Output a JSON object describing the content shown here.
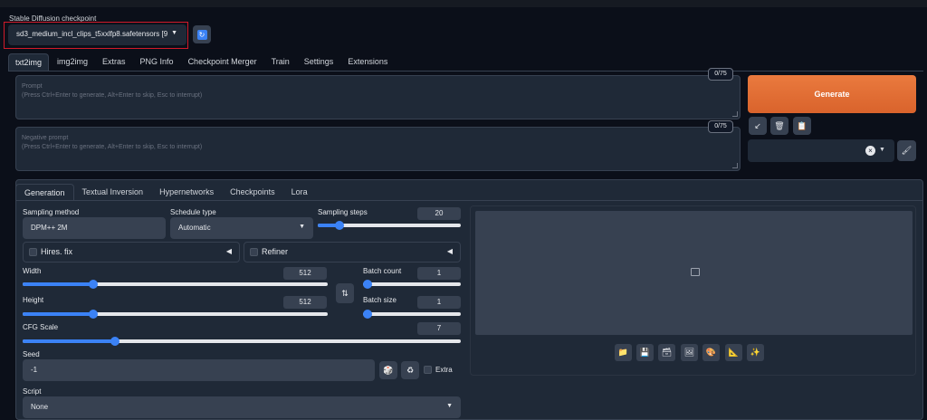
{
  "checkpoint": {
    "label": "Stable Diffusion checkpoint",
    "value": "sd3_medium_incl_clips_t5xxlfp8.safetensors [9"
  },
  "main_tabs": [
    {
      "label": "txt2img",
      "active": true
    },
    {
      "label": "img2img"
    },
    {
      "label": "Extras"
    },
    {
      "label": "PNG Info"
    },
    {
      "label": "Checkpoint Merger"
    },
    {
      "label": "Train"
    },
    {
      "label": "Settings"
    },
    {
      "label": "Extensions"
    }
  ],
  "prompt": {
    "placeholder_title": "Prompt",
    "placeholder_hint": "(Press Ctrl+Enter to generate, Alt+Enter to skip, Esc to interrupt)",
    "counter": "0/75"
  },
  "negative_prompt": {
    "placeholder_title": "Negative prompt",
    "placeholder_hint": "(Press Ctrl+Enter to generate, Alt+Enter to skip, Esc to interrupt)",
    "counter": "0/75"
  },
  "generate_label": "Generate",
  "sub_tabs": [
    {
      "label": "Generation",
      "active": true
    },
    {
      "label": "Textual Inversion"
    },
    {
      "label": "Hypernetworks"
    },
    {
      "label": "Checkpoints"
    },
    {
      "label": "Lora"
    }
  ],
  "sampling_method": {
    "label": "Sampling method",
    "value": "DPM++ 2M"
  },
  "schedule_type": {
    "label": "Schedule type",
    "value": "Automatic"
  },
  "sampling_steps": {
    "label": "Sampling steps",
    "value": "20",
    "fraction": 0.15
  },
  "hires_fix": {
    "label": "Hires. fix",
    "checked": false
  },
  "refiner": {
    "label": "Refiner",
    "checked": false
  },
  "width": {
    "label": "Width",
    "value": "512",
    "fraction": 0.23
  },
  "height": {
    "label": "Height",
    "value": "512",
    "fraction": 0.23
  },
  "batch_count": {
    "label": "Batch count",
    "value": "1",
    "fraction": 0.0
  },
  "batch_size": {
    "label": "Batch size",
    "value": "1",
    "fraction": 0.0
  },
  "cfg_scale": {
    "label": "CFG Scale",
    "value": "7",
    "fraction": 0.21
  },
  "seed": {
    "label": "Seed",
    "value": "-1",
    "extra_label": "Extra"
  },
  "script": {
    "label": "Script",
    "value": "None"
  },
  "icons": {
    "swap": "⇅",
    "caret_down": "▼",
    "triangle_left": "◀"
  },
  "colors": {
    "accent": "#3b82f6",
    "generate": "#e0702f",
    "background": "#0b0f19"
  }
}
